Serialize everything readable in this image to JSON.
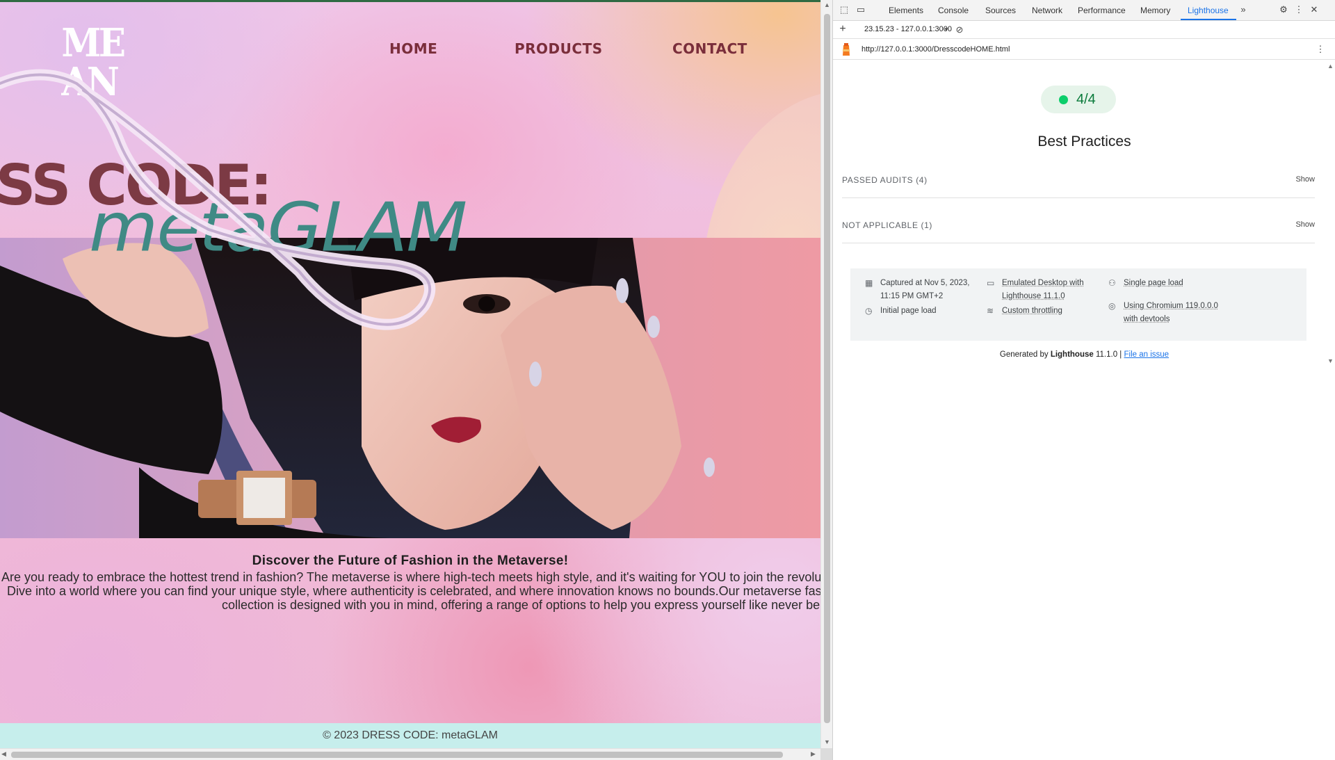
{
  "site": {
    "logo": {
      "line1": "ME",
      "line2": "AN"
    },
    "nav": {
      "home": "HOME",
      "products": "PRODUCTS",
      "contact": "CONTACT"
    },
    "hero": {
      "title": "ESS CODE:",
      "subtitle": "metaGLAM"
    },
    "intro": {
      "heading": "Discover the Future of Fashion in the Metaverse!",
      "line1": "Are you ready to embrace the hottest trend in fashion? The metaverse is where high-tech meets high style, and it's waiting for YOU to join the revolu",
      "line2": "Dive into a world where you can find your unique style, where authenticity is celebrated, and where innovation knows no bounds.Our metaverse fas",
      "line3": "collection is designed with you in mind, offering a range of options to help you express yourself like never be"
    },
    "footer": "© 2023 DRESS CODE: metaGLAM",
    "colors": {
      "nav": "#7a2e3b",
      "title": "#7c3a44",
      "subtitle": "#3f8a85",
      "footer_bg": "#c6eeec"
    }
  },
  "devtools": {
    "tabs": [
      "Elements",
      "Console",
      "Sources",
      "Network",
      "Performance",
      "Memory",
      "Lighthouse"
    ],
    "active_tab": "Lighthouse",
    "report_select": "23.15.23 - 127.0.0.1:3000",
    "url": "http://127.0.0.1:3000/DresscodeHOME.html",
    "score": "4/4",
    "category": "Best Practices",
    "groups": [
      {
        "label": "PASSED AUDITS (4)",
        "action": "Show"
      },
      {
        "label": "NOT APPLICABLE (1)",
        "action": "Show"
      }
    ],
    "meta": {
      "captured_l1": "Captured at Nov 5, 2023,",
      "captured_l2": "11:15 PM GMT+2",
      "initial": "Initial page load",
      "emulated_l1": "Emulated Desktop with",
      "emulated_l2": "Lighthouse 11.1.0",
      "throttling": "Custom throttling",
      "single": "Single page load",
      "chromium_l1": "Using Chromium 119.0.0.0",
      "chromium_l2": "with devtools"
    },
    "generated_by": "Generated by",
    "generator": "Lighthouse",
    "version": "11.1.0 |",
    "file_issue": "File an issue",
    "colors": {
      "accent": "#1a73e8",
      "pass": "#0cce6b"
    }
  }
}
